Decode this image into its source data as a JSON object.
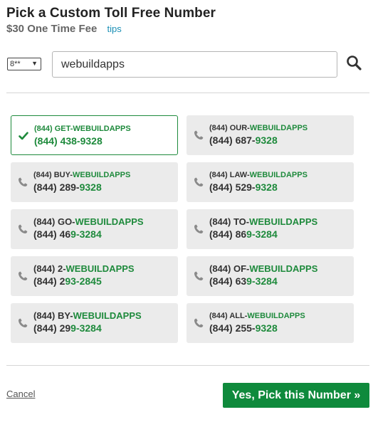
{
  "header": {
    "title": "Pick a Custom Toll Free Number",
    "fee": "$30 One Time Fee",
    "tips_label": "tips"
  },
  "search": {
    "prefix_value": "8**",
    "query_value": "webuildapps"
  },
  "numbers": [
    {
      "vanity_a": "(844) GET-",
      "vanity_b": "WEBUILDAPPS",
      "num_a": "(844) 438-9328",
      "num_b": "",
      "selected": true
    },
    {
      "vanity_a": "(844) OUR-",
      "vanity_b": "WEBUILDAPPS",
      "num_a": "(844) 687-",
      "num_b": "9328",
      "selected": false
    },
    {
      "vanity_a": "(844) BUY-",
      "vanity_b": "WEBUILDAPPS",
      "num_a": "(844) 289-",
      "num_b": "9328",
      "selected": false
    },
    {
      "vanity_a": "(844) LAW-",
      "vanity_b": "WEBUILDAPPS",
      "num_a": "(844) 529-",
      "num_b": "9328",
      "selected": false
    },
    {
      "vanity_a": "(844) GO-",
      "vanity_b": "WEBUILDAPPS",
      "num_a": "(844) 46",
      "num_b": "9-3284",
      "selected": false
    },
    {
      "vanity_a": "(844) TO-",
      "vanity_b": "WEBUILDAPPS",
      "num_a": "(844) 86",
      "num_b": "9-3284",
      "selected": false
    },
    {
      "vanity_a": "(844) 2-",
      "vanity_b": "WEBUILDAPPS",
      "num_a": "(844) 2",
      "num_b": "93-2845",
      "selected": false
    },
    {
      "vanity_a": "(844) OF-",
      "vanity_b": "WEBUILDAPPS",
      "num_a": "(844) 63",
      "num_b": "9-3284",
      "selected": false
    },
    {
      "vanity_a": "(844) BY-",
      "vanity_b": "WEBUILDAPPS",
      "num_a": "(844) 29",
      "num_b": "9-3284",
      "selected": false
    },
    {
      "vanity_a": "(844) ALL-",
      "vanity_b": "WEBUILDAPPS",
      "num_a": "(844) 255-",
      "num_b": "9328",
      "selected": false
    }
  ],
  "footer": {
    "cancel_label": "Cancel",
    "confirm_label": "Yes, Pick this Number »"
  },
  "icons": {
    "selected": "checkmark-icon",
    "unselected": "phone-icon",
    "search": "search-icon"
  },
  "colors": {
    "accent_green": "#1e8a3c",
    "button_green": "#0f8a3c",
    "card_bg": "#ebebeb",
    "link_blue": "#1a8fb5"
  }
}
